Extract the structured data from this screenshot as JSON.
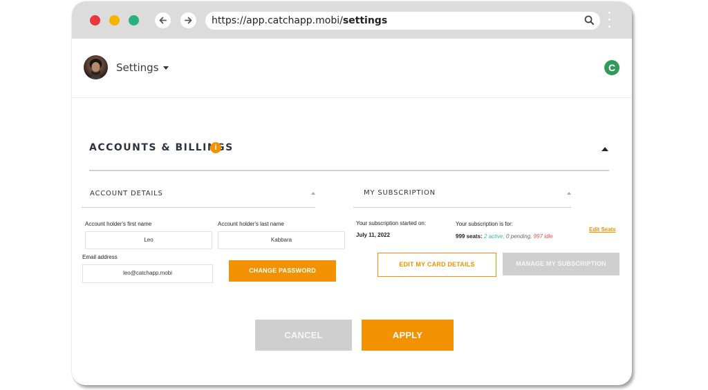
{
  "browser": {
    "url_prefix": "https://app.catchapp.mobi/",
    "url_bold": "settings",
    "traffic_lights": {
      "red": "#e8383d",
      "yellow": "#f5b400",
      "green": "#2ab07a"
    }
  },
  "header": {
    "menu_label": "Settings",
    "brand_letter": "C",
    "brand_color": "#2f9a5a"
  },
  "section": {
    "title": "ACCOUNTS & BILLINGS",
    "info_glyph": "i"
  },
  "account_details": {
    "title": "ACCOUNT DETAILS",
    "first_name_label": "Account holder's first name",
    "first_name_value": "Leo",
    "last_name_label": "Account holder's last name",
    "last_name_value": "Kabbara",
    "email_label": "Email address",
    "email_value": "leo@catchapp.mobi",
    "change_password_label": "CHANGE PASSWORD"
  },
  "subscription": {
    "title": "MY SUBSCRIPTION",
    "started_label": "Your subscription started on:",
    "started_value": "July 11, 2022",
    "for_label": "Your subscription is for:",
    "seats": "999 seats:",
    "active": "2 active,",
    "pending": "0 pending,",
    "idle": "997 idle",
    "edit_seats_label": "Edit Seats",
    "edit_card_label": "EDIT MY CARD DETAILS",
    "manage_label": "MANAGE MY SUBSCRIPTION"
  },
  "actions": {
    "cancel_label": "CANCEL",
    "apply_label": "APPLY"
  },
  "colors": {
    "accent": "#f39200",
    "disabled": "#cfcfcf"
  }
}
